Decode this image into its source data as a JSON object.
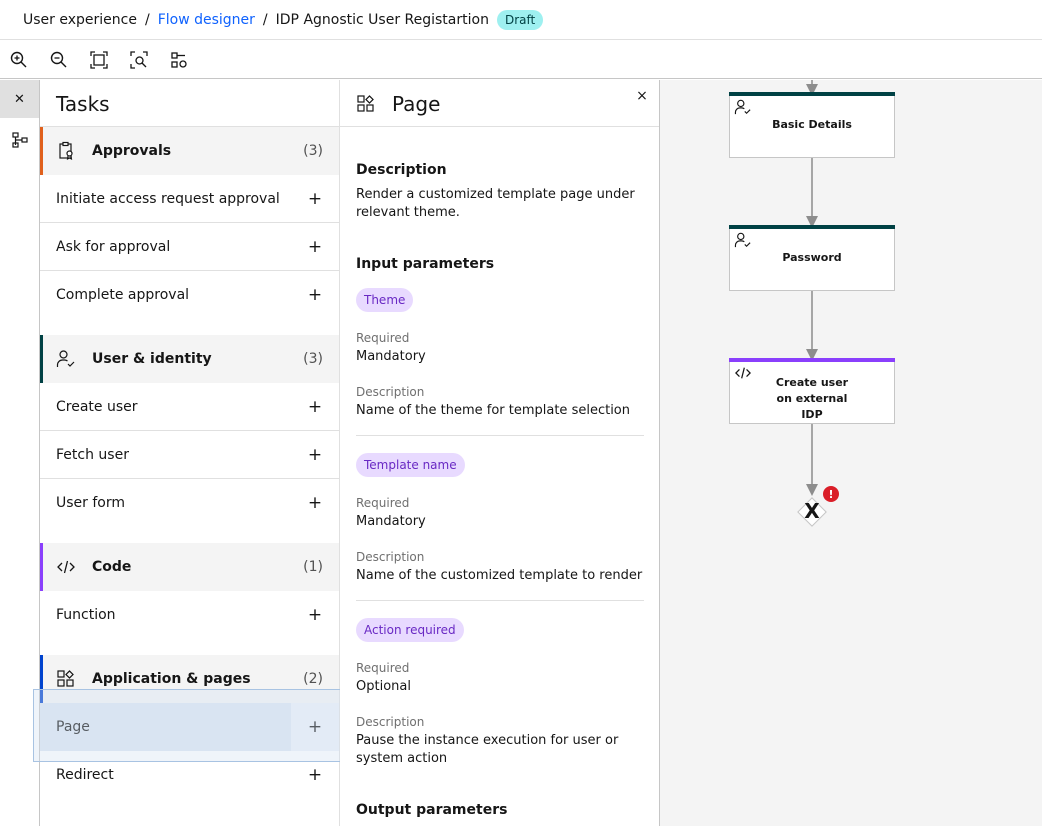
{
  "breadcrumb": {
    "root": "User experience",
    "link": "Flow designer",
    "current": "IDP Agnostic User Registartion",
    "status": "Draft",
    "separator": "/"
  },
  "toolbar": {
    "buttons": [
      "zoom-in-icon",
      "zoom-out-icon",
      "fit-to-screen-icon",
      "zoom-area-icon",
      "flow-settings-icon"
    ]
  },
  "rail": {
    "close_glyph": "✕"
  },
  "tasks": {
    "title": "Tasks",
    "categories": [
      {
        "label": "Approvals",
        "count": "(3)",
        "color": "#e0601c",
        "icon": "approval-icon",
        "items": [
          "Initiate access request approval",
          "Ask for approval",
          "Complete approval"
        ]
      },
      {
        "label": "User & identity",
        "count": "(3)",
        "color": "#004144",
        "icon": "user-check-icon",
        "items": [
          "Create user",
          "Fetch user",
          "User form"
        ]
      },
      {
        "label": "Code",
        "count": "(1)",
        "color": "#8a3ffc",
        "icon": "code-icon",
        "items": [
          "Function"
        ]
      },
      {
        "label": "Application & pages",
        "count": "(2)",
        "color": "#0043ce",
        "icon": "application-icon",
        "items": [
          "Page",
          "Redirect"
        ]
      }
    ],
    "plus_glyph": "+"
  },
  "detail": {
    "title": "Page",
    "close_glyph": "×",
    "description_heading": "Description",
    "description": "Render a customized template page under relevant theme.",
    "input_heading": "Input parameters",
    "params": [
      {
        "tag": "Theme",
        "required_label": "Required",
        "required": "Mandatory",
        "desc_label": "Description",
        "desc": "Name of the theme for template selection"
      },
      {
        "tag": "Template name",
        "required_label": "Required",
        "required": "Mandatory",
        "desc_label": "Description",
        "desc": "Name of the customized template to render"
      },
      {
        "tag": "Action required",
        "required_label": "Required",
        "required": "Optional",
        "desc_label": "Description",
        "desc": "Pause the instance execution for user or system action"
      }
    ],
    "output_heading": "Output parameters"
  },
  "canvas": {
    "nodes": [
      {
        "label": "Basic Details",
        "color": "#004144",
        "icon": "user-check-icon"
      },
      {
        "label": "Password",
        "color": "#004144",
        "icon": "user-check-icon"
      },
      {
        "label": "Create user on external IDP",
        "color": "#8a3ffc",
        "icon": "code-icon"
      }
    ],
    "end_glyph": "X",
    "error_glyph": "!",
    "error_color": "#da1e28"
  }
}
